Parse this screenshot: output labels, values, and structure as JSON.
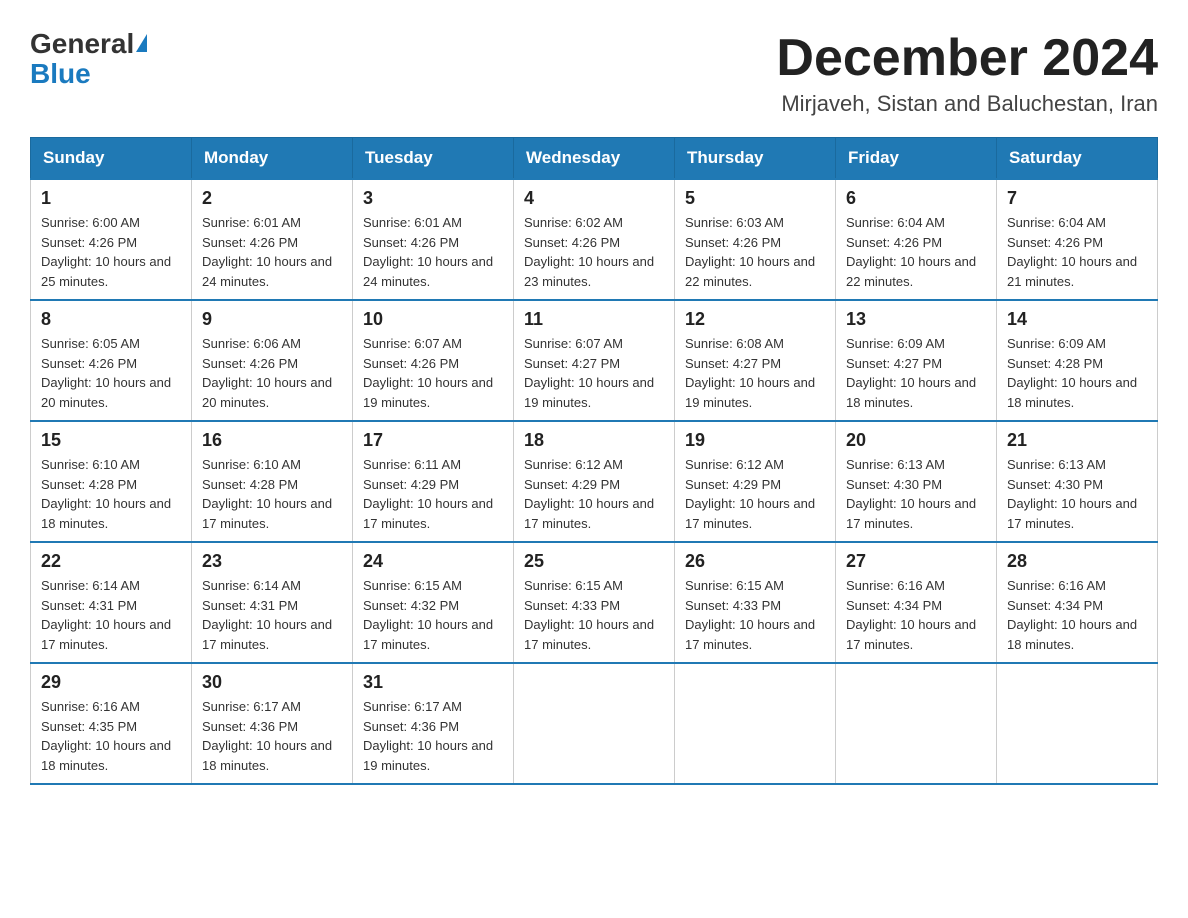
{
  "header": {
    "logo_general": "General",
    "logo_blue": "Blue",
    "month_title": "December 2024",
    "location": "Mirjaveh, Sistan and Baluchestan, Iran"
  },
  "weekdays": [
    "Sunday",
    "Monday",
    "Tuesday",
    "Wednesday",
    "Thursday",
    "Friday",
    "Saturday"
  ],
  "weeks": [
    [
      {
        "day": "1",
        "sunrise": "6:00 AM",
        "sunset": "4:26 PM",
        "daylight": "10 hours and 25 minutes."
      },
      {
        "day": "2",
        "sunrise": "6:01 AM",
        "sunset": "4:26 PM",
        "daylight": "10 hours and 24 minutes."
      },
      {
        "day": "3",
        "sunrise": "6:01 AM",
        "sunset": "4:26 PM",
        "daylight": "10 hours and 24 minutes."
      },
      {
        "day": "4",
        "sunrise": "6:02 AM",
        "sunset": "4:26 PM",
        "daylight": "10 hours and 23 minutes."
      },
      {
        "day": "5",
        "sunrise": "6:03 AM",
        "sunset": "4:26 PM",
        "daylight": "10 hours and 22 minutes."
      },
      {
        "day": "6",
        "sunrise": "6:04 AM",
        "sunset": "4:26 PM",
        "daylight": "10 hours and 22 minutes."
      },
      {
        "day": "7",
        "sunrise": "6:04 AM",
        "sunset": "4:26 PM",
        "daylight": "10 hours and 21 minutes."
      }
    ],
    [
      {
        "day": "8",
        "sunrise": "6:05 AM",
        "sunset": "4:26 PM",
        "daylight": "10 hours and 20 minutes."
      },
      {
        "day": "9",
        "sunrise": "6:06 AM",
        "sunset": "4:26 PM",
        "daylight": "10 hours and 20 minutes."
      },
      {
        "day": "10",
        "sunrise": "6:07 AM",
        "sunset": "4:26 PM",
        "daylight": "10 hours and 19 minutes."
      },
      {
        "day": "11",
        "sunrise": "6:07 AM",
        "sunset": "4:27 PM",
        "daylight": "10 hours and 19 minutes."
      },
      {
        "day": "12",
        "sunrise": "6:08 AM",
        "sunset": "4:27 PM",
        "daylight": "10 hours and 19 minutes."
      },
      {
        "day": "13",
        "sunrise": "6:09 AM",
        "sunset": "4:27 PM",
        "daylight": "10 hours and 18 minutes."
      },
      {
        "day": "14",
        "sunrise": "6:09 AM",
        "sunset": "4:28 PM",
        "daylight": "10 hours and 18 minutes."
      }
    ],
    [
      {
        "day": "15",
        "sunrise": "6:10 AM",
        "sunset": "4:28 PM",
        "daylight": "10 hours and 18 minutes."
      },
      {
        "day": "16",
        "sunrise": "6:10 AM",
        "sunset": "4:28 PM",
        "daylight": "10 hours and 17 minutes."
      },
      {
        "day": "17",
        "sunrise": "6:11 AM",
        "sunset": "4:29 PM",
        "daylight": "10 hours and 17 minutes."
      },
      {
        "day": "18",
        "sunrise": "6:12 AM",
        "sunset": "4:29 PM",
        "daylight": "10 hours and 17 minutes."
      },
      {
        "day": "19",
        "sunrise": "6:12 AM",
        "sunset": "4:29 PM",
        "daylight": "10 hours and 17 minutes."
      },
      {
        "day": "20",
        "sunrise": "6:13 AM",
        "sunset": "4:30 PM",
        "daylight": "10 hours and 17 minutes."
      },
      {
        "day": "21",
        "sunrise": "6:13 AM",
        "sunset": "4:30 PM",
        "daylight": "10 hours and 17 minutes."
      }
    ],
    [
      {
        "day": "22",
        "sunrise": "6:14 AM",
        "sunset": "4:31 PM",
        "daylight": "10 hours and 17 minutes."
      },
      {
        "day": "23",
        "sunrise": "6:14 AM",
        "sunset": "4:31 PM",
        "daylight": "10 hours and 17 minutes."
      },
      {
        "day": "24",
        "sunrise": "6:15 AM",
        "sunset": "4:32 PM",
        "daylight": "10 hours and 17 minutes."
      },
      {
        "day": "25",
        "sunrise": "6:15 AM",
        "sunset": "4:33 PM",
        "daylight": "10 hours and 17 minutes."
      },
      {
        "day": "26",
        "sunrise": "6:15 AM",
        "sunset": "4:33 PM",
        "daylight": "10 hours and 17 minutes."
      },
      {
        "day": "27",
        "sunrise": "6:16 AM",
        "sunset": "4:34 PM",
        "daylight": "10 hours and 17 minutes."
      },
      {
        "day": "28",
        "sunrise": "6:16 AM",
        "sunset": "4:34 PM",
        "daylight": "10 hours and 18 minutes."
      }
    ],
    [
      {
        "day": "29",
        "sunrise": "6:16 AM",
        "sunset": "4:35 PM",
        "daylight": "10 hours and 18 minutes."
      },
      {
        "day": "30",
        "sunrise": "6:17 AM",
        "sunset": "4:36 PM",
        "daylight": "10 hours and 18 minutes."
      },
      {
        "day": "31",
        "sunrise": "6:17 AM",
        "sunset": "4:36 PM",
        "daylight": "10 hours and 19 minutes."
      },
      null,
      null,
      null,
      null
    ]
  ],
  "labels": {
    "sunrise_prefix": "Sunrise: ",
    "sunset_prefix": "Sunset: ",
    "daylight_prefix": "Daylight: "
  }
}
